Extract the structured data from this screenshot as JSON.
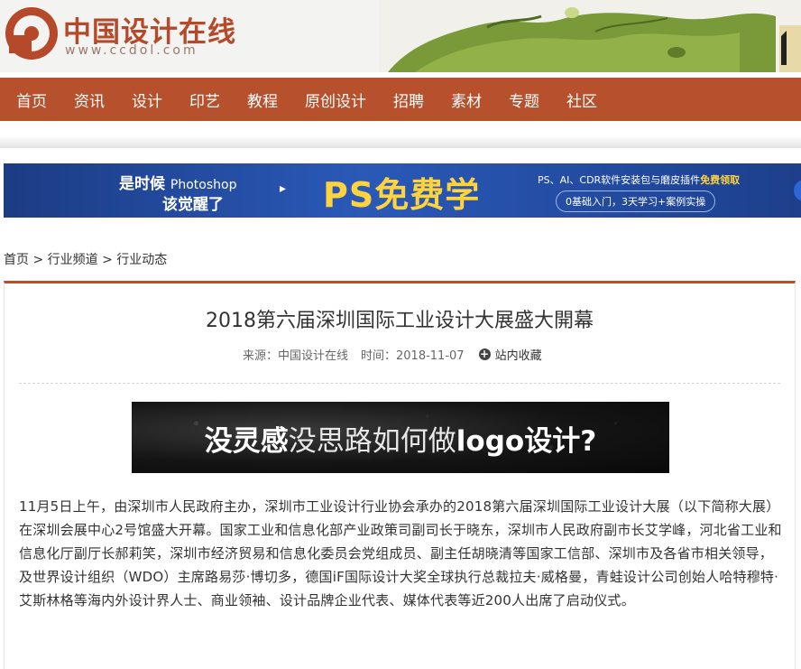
{
  "header": {
    "logo_cn": "中国设计在线",
    "logo_url": "www.ccdol.com"
  },
  "nav": {
    "items": [
      "首页",
      "资讯",
      "设计",
      "印艺",
      "教程",
      "原创设计",
      "招聘",
      "素材",
      "专题",
      "社区"
    ]
  },
  "banner": {
    "line1_a": "是时候",
    "line1_b": "Photoshop",
    "line2": "该觉醒了",
    "arrow": "▸",
    "headline": "PS免费学",
    "right_line1_a": "PS、AI、CDR软件安装包与磨皮插件",
    "right_line1_b": "免费领取",
    "right_line2": "0基础入门，3天学习+案例实操"
  },
  "breadcrumb": {
    "items": [
      "首页",
      "行业频道",
      "行业动态"
    ],
    "separator": " > "
  },
  "article": {
    "title": "2018第六届深圳国际工业设计大展盛大開幕",
    "source_label": "来源：中国设计在线",
    "time_label": "时间：2018-11-07",
    "favorite_label": "站内收藏",
    "favorite_icon": "plus-circle",
    "ad_text_bold": "没灵感",
    "ad_text_light": "没思路如何做",
    "ad_text_logo": "logo设计?",
    "body": "11月5日上午，由深圳市人民政府主办，深圳市工业设计行业协会承办的2018第六届深圳国际工业设计大展（以下简称大展）在深圳会展中心2号馆盛大开幕。国家工业和信息化部产业政策司副司长于晓东，深圳市人民政府副市长艾学峰，河北省工业和信息化厅副厅长郝莉笑，深圳市经济贸易和信息化委员会党组成员、副主任胡晓清等国家工信部、深圳市及各省市相关领导，及世界设计组织（WDO）主席路易莎·博切多，德国iF国际设计大奖全球执行总裁拉夫·威格曼，青蛙设计公司创始人哈特穆特·艾斯林格等海内外设计界人士、商业领袖、设计品牌企业代表、媒体代表等近200人出席了启动仪式。"
  },
  "colors": {
    "brand": "#b7502c",
    "banner_bg": "#2a59b8",
    "banner_accent": "#ffd33d"
  }
}
